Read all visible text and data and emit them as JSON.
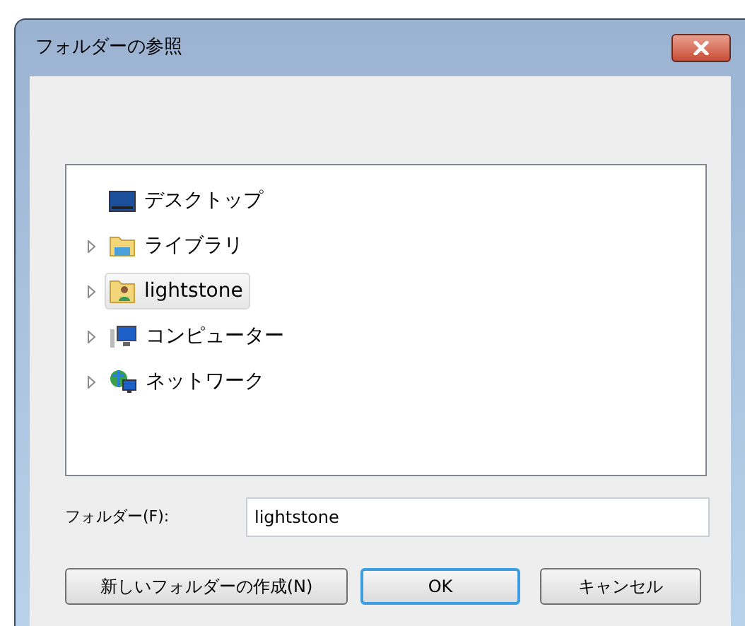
{
  "window": {
    "title": "フォルダーの参照"
  },
  "tree": {
    "items": [
      {
        "label": "デスクトップ",
        "kind": "desktop",
        "expandable": false,
        "selected": false
      },
      {
        "label": "ライブラリ",
        "kind": "library",
        "expandable": true,
        "selected": false
      },
      {
        "label": "lightstone",
        "kind": "user",
        "expandable": true,
        "selected": true
      },
      {
        "label": "コンピューター",
        "kind": "computer",
        "expandable": true,
        "selected": false
      },
      {
        "label": "ネットワーク",
        "kind": "network",
        "expandable": true,
        "selected": false
      }
    ]
  },
  "folder_field": {
    "label": "フォルダー(F):",
    "value": "lightstone"
  },
  "buttons": [
    {
      "label": "新しいフォルダーの作成(N)",
      "default": false
    },
    {
      "label": "OK",
      "default": true
    },
    {
      "label": "キャンセル",
      "default": false
    }
  ]
}
